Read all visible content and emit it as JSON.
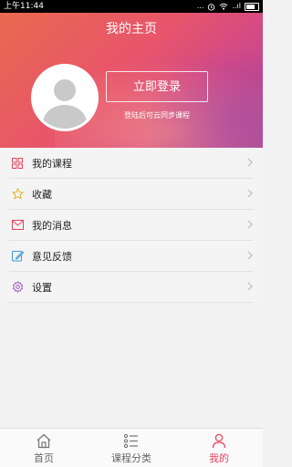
{
  "statusbar": {
    "time": "上午11:44",
    "dots": "...",
    "signal_text": "..ıl"
  },
  "header": {
    "title": "我的主页"
  },
  "profile": {
    "login_button": "立即登录",
    "login_hint": "登陆后可云同步课程"
  },
  "menu": {
    "items": [
      {
        "label": "我的课程",
        "icon": "grid-icon"
      },
      {
        "label": "收藏",
        "icon": "star-icon"
      },
      {
        "label": "我的消息",
        "icon": "envelope-icon"
      },
      {
        "label": "意见反馈",
        "icon": "edit-icon"
      },
      {
        "label": "设置",
        "icon": "gear-icon"
      }
    ]
  },
  "tabs": [
    {
      "label": "首页",
      "icon": "home-icon"
    },
    {
      "label": "课程分类",
      "icon": "list-icon"
    },
    {
      "label": "我的",
      "icon": "user-icon",
      "active": true
    }
  ],
  "colors": {
    "accent": "#e8455d",
    "hero_start": "#e9694f",
    "hero_end": "#a84498"
  }
}
